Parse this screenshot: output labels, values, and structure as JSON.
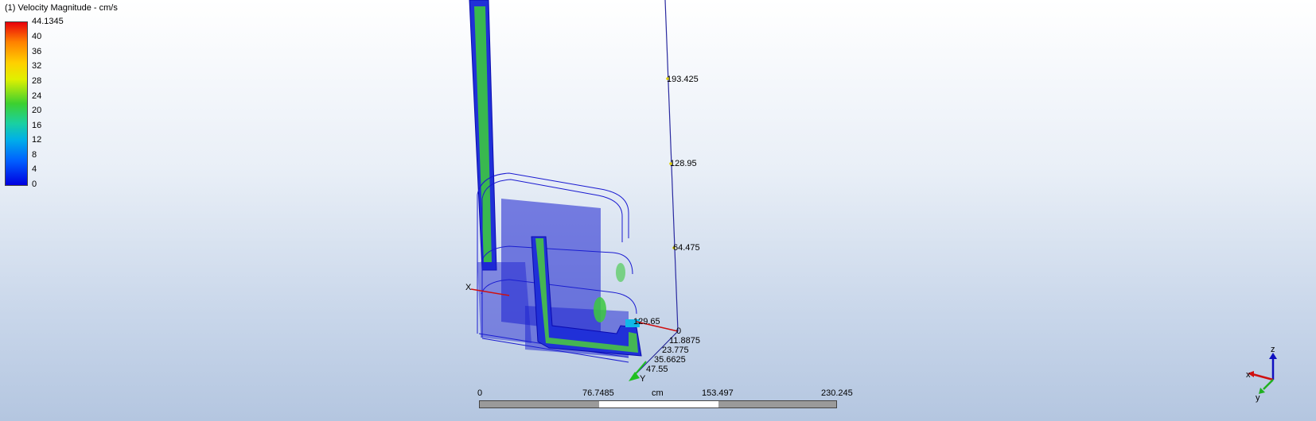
{
  "legend": {
    "title": "(1) Velocity Magnitude - cm/s",
    "max_label": "44.1345",
    "labels": [
      "40",
      "36",
      "32",
      "28",
      "24",
      "20",
      "16",
      "12",
      "8",
      "4",
      "0"
    ]
  },
  "model_axis_labels": {
    "vertical": [
      "193.425",
      "128.95",
      "64.475",
      "0"
    ],
    "depth": [
      "11.8875",
      "23.775",
      "35.6625",
      "47.55"
    ],
    "horizontal_partial": "129.65",
    "x": "X",
    "y": "Y"
  },
  "scale": {
    "labels": [
      "0",
      "76.7485",
      "cm",
      "153.497",
      "230.245"
    ]
  },
  "triad": {
    "z": "z",
    "x": "x",
    "y": "y"
  },
  "colors": {
    "colormap_high": "#e8000b",
    "colormap_low": "#0000e0",
    "model_blue": "#1a1ad0",
    "flow_green": "#3cc840"
  }
}
